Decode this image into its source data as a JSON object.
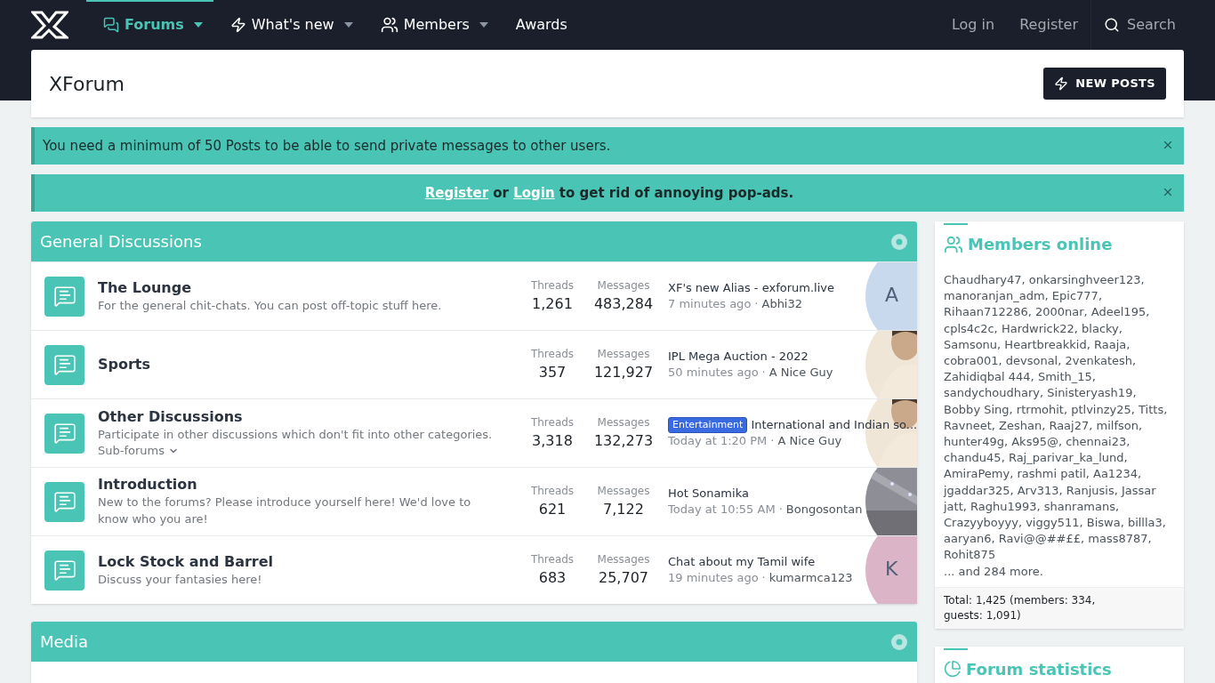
{
  "nav": {
    "items": [
      {
        "label": "Forums",
        "dropdown": true,
        "selected": true
      },
      {
        "label": "What's new",
        "dropdown": true,
        "selected": false
      },
      {
        "label": "Members",
        "dropdown": true,
        "selected": false
      },
      {
        "label": "Awards",
        "dropdown": false,
        "selected": false
      }
    ],
    "right": [
      "Log in",
      "Register"
    ],
    "search": "Search"
  },
  "header": {
    "title": "XForum",
    "button": "NEW POSTS"
  },
  "notices": [
    {
      "kind": "info",
      "parts": [
        {
          "kind": "text",
          "text": "You need a minimum of 50 Posts to be able to send private messages to other users."
        }
      ]
    },
    {
      "kind": "promo",
      "parts": [
        {
          "kind": "link",
          "text": "Register"
        },
        {
          "kind": "text",
          "text": " or "
        },
        {
          "kind": "link",
          "text": "Login"
        },
        {
          "kind": "text",
          "text": " to get rid of annoying pop-ads."
        }
      ]
    }
  ],
  "categories": [
    {
      "title": "General Discussions",
      "forums": [
        {
          "name": "The Lounge",
          "description": "For the general chit-chats. You can post off-topic stuff here.",
          "threads_label": "Threads",
          "threads": "1,261",
          "messages_label": "Messages",
          "messages": "483,284",
          "last_title": "XF's new Alias - exforum.live",
          "last_meta": "7 minutes ago",
          "separator": "·",
          "last_user": "Abhi32",
          "avatar": {
            "kind": "letter",
            "letter": "A",
            "color": "#c8d9ee"
          }
        },
        {
          "name": "Sports",
          "threads_label": "Threads",
          "threads": "357",
          "messages_label": "Messages",
          "messages": "121,927",
          "last_title": "IPL Mega Auction - 2022",
          "last_meta": "50 minutes ago",
          "separator": "·",
          "last_user": "A Nice Guy"
        },
        {
          "name": "Other Discussions",
          "description": "Participate in other discussions which don't fit into other categories.",
          "subforums": "Sub-forums",
          "threads_label": "Threads",
          "threads": "3,318",
          "messages_label": "Messages",
          "messages": "132,273",
          "prefix": "Entertainment",
          "last_title": "International and Indian so...",
          "last_meta": "Today at 1:20 PM",
          "separator": "·",
          "last_user": "A Nice Guy"
        },
        {
          "name": "Introduction",
          "description": "New to the forums? Please introduce yourself here! We'd love to know who you are!",
          "threads_label": "Threads",
          "threads": "621",
          "messages_label": "Messages",
          "messages": "7,122",
          "last_title": "Hot Sonamika",
          "last_meta": "Today at 10:55 AM",
          "separator": "·",
          "last_user": "Bongosontan",
          "avatar": {
            "kind": "night"
          }
        },
        {
          "name": "Lock Stock and Barrel",
          "description": "Discuss your fantasies here!",
          "threads_label": "Threads",
          "threads": "683",
          "messages_label": "Messages",
          "messages": "25,707",
          "last_title": "Chat about my Tamil wife",
          "last_meta": "19 minutes ago",
          "separator": "·",
          "last_user": "kumarmca123",
          "avatar": {
            "kind": "letter",
            "letter": "K",
            "color": "#dcb4c8"
          }
        }
      ]
    },
    {
      "title": "Media"
    }
  ],
  "sidebar": {
    "members_online": {
      "title": "Members online",
      "list": "Chaudhary47, onkarsinghveer123, manoranjan_adm, Epic777, Rihaan712286, 2000nar, Adeel195, cpls4c2c, Hardwrick22, blacky, Samsonu, Heartbreakkid, Raaja, cobra001, devsonal, 2venkatesh, Zahidiqbal 444, Smith_15, sandychoudhary, Sinisteryash19, Bobby Sing, rtrmohit, ptlvinzy25, Titts, Ravneet, Zeshan, Raaj27, milfson, hunter49g, Aks95@, chennai23, chandu45, Raj_parivar_ka_lund, AmiraPemy, rashmi patil, Aa1234, jgaddar325, Arv313, Ranjusis, Jassar jatt, Raghu1993, shanramans, Crazyyboyyy, viggy511, Biswa, billla3, aaryan6, Ravi@@##££, mass8787, Rohit875",
      "more": "... and 284 more.",
      "total": "Total: 1,425 (members: 334, guests: 1,091)"
    },
    "forum_statistics": {
      "title": "Forum statistics"
    }
  }
}
